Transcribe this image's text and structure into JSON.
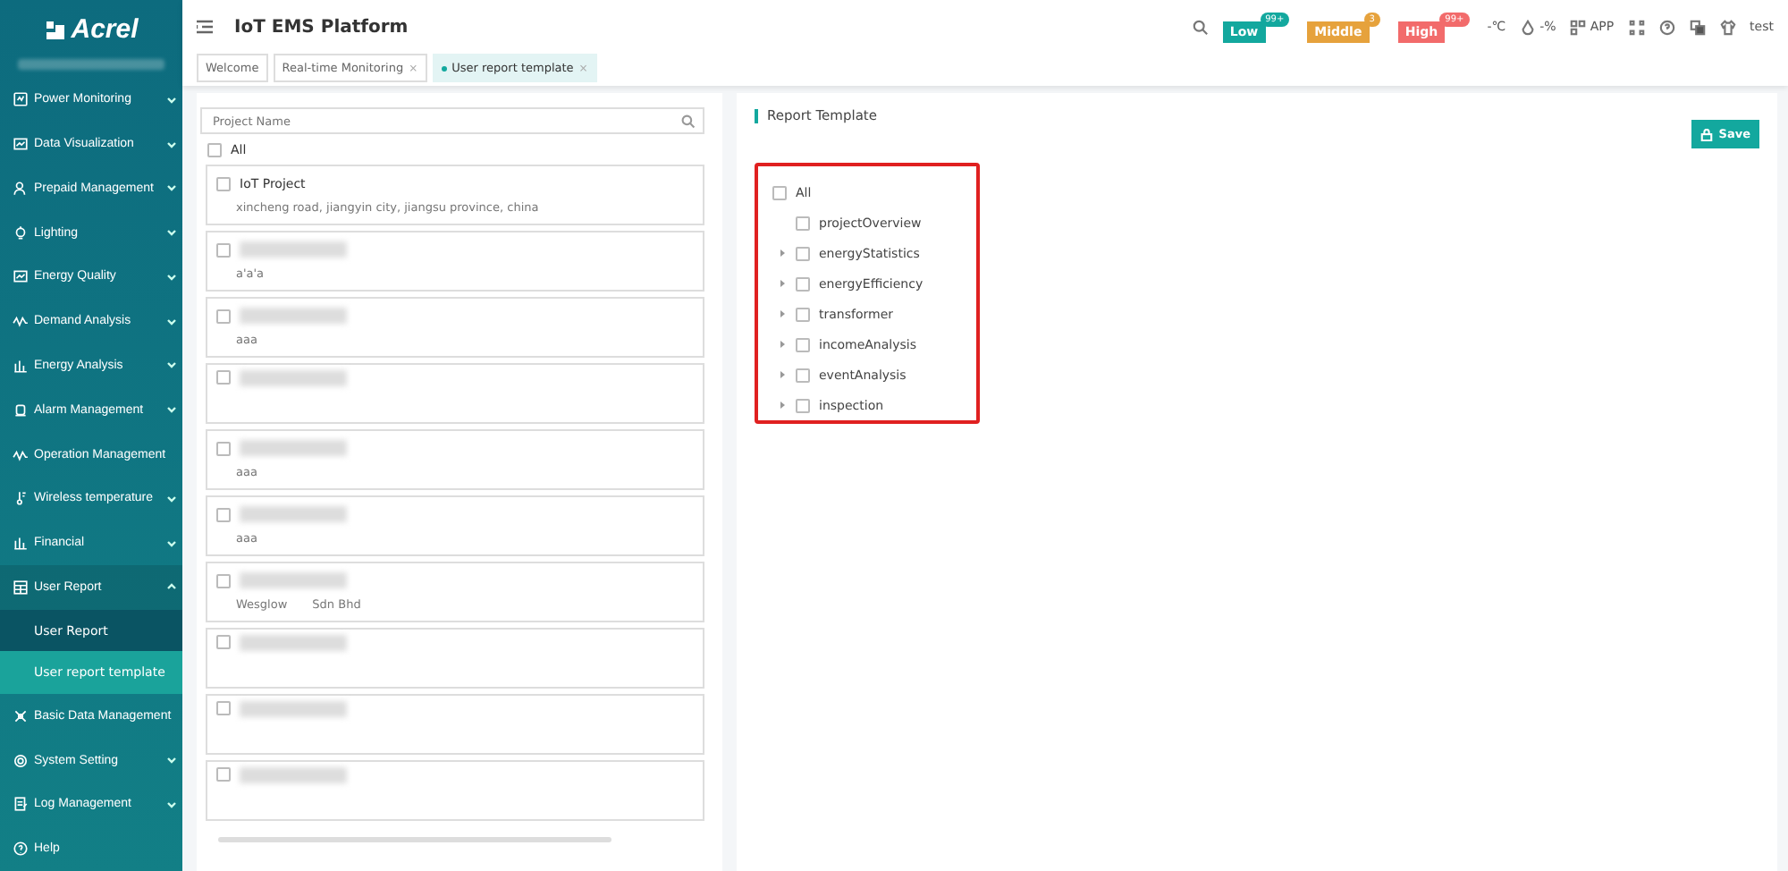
{
  "brand": {
    "name": "Acrel"
  },
  "header": {
    "title": "IoT EMS Platform",
    "alarms": [
      {
        "label": "Low",
        "count": "99+",
        "color": "#13a89e"
      },
      {
        "label": "Middle",
        "count": "3",
        "color": "#e6a23c"
      },
      {
        "label": "High",
        "count": "99+",
        "color": "#f26b6b"
      }
    ],
    "temperature": "-℃",
    "humidity": "-%",
    "app": "APP",
    "user": "test"
  },
  "tabs": [
    {
      "label": "Welcome",
      "selected": false
    },
    {
      "label": "Real-time Monitoring",
      "selected": false,
      "close": "×"
    },
    {
      "label": "User report template",
      "selected": true,
      "close": "×"
    }
  ],
  "sidebar": {
    "items": [
      {
        "label": "Power Monitoring",
        "expanded": false
      },
      {
        "label": "Data Visualization",
        "expanded": false
      },
      {
        "label": "Prepaid Management",
        "expanded": false
      },
      {
        "label": "Lighting",
        "expanded": false
      },
      {
        "label": "Energy Quality",
        "expanded": false
      },
      {
        "label": "Demand Analysis",
        "expanded": false
      },
      {
        "label": "Energy Analysis",
        "expanded": false
      },
      {
        "label": "Alarm Management",
        "expanded": false
      },
      {
        "label": "Operation Management"
      },
      {
        "label": "Wireless temperature",
        "expanded": false
      },
      {
        "label": "Financial",
        "expanded": false
      },
      {
        "label": "User Report",
        "expanded": true,
        "children": [
          {
            "label": "User Report",
            "selected": false
          },
          {
            "label": "User report template",
            "selected": true
          }
        ]
      },
      {
        "label": "Basic Data Management"
      },
      {
        "label": "System Setting",
        "expanded": false
      },
      {
        "label": "Log Management",
        "expanded": false
      },
      {
        "label": "Help"
      }
    ]
  },
  "projects": {
    "placeholder": "Project Name",
    "all_label": "All",
    "all_checked": false,
    "items": [
      {
        "name": "IoT Project",
        "address": [
          "xincheng road, jiangyin city, jiangsu province, china"
        ],
        "checked": false
      },
      {
        "address": [
          "a'a'a"
        ],
        "checked": false
      },
      {
        "address": [
          "aaa"
        ],
        "checked": false
      },
      {
        "checked": false
      },
      {
        "address": [
          "aaa"
        ],
        "checked": false
      },
      {
        "address": [
          "aaa"
        ],
        "checked": false
      },
      {
        "address": [
          "Wesglow",
          "Sdn Bhd"
        ],
        "checked": false
      },
      {
        "checked": false
      },
      {
        "checked": false
      },
      {
        "checked": false
      }
    ]
  },
  "report_template": {
    "title": "Report Template",
    "save": "Save",
    "all_label": "All",
    "all_checked": false,
    "items": [
      {
        "label": "projectOverview",
        "expandable": false,
        "checked": false
      },
      {
        "label": "energyStatistics",
        "expandable": true,
        "checked": false
      },
      {
        "label": "energyEfficiency",
        "expandable": true,
        "checked": false
      },
      {
        "label": "transformer",
        "expandable": true,
        "checked": false
      },
      {
        "label": "incomeAnalysis",
        "expandable": true,
        "checked": false
      },
      {
        "label": "eventAnalysis",
        "expandable": true,
        "checked": false
      },
      {
        "label": "inspection",
        "expandable": true,
        "checked": false
      }
    ]
  }
}
